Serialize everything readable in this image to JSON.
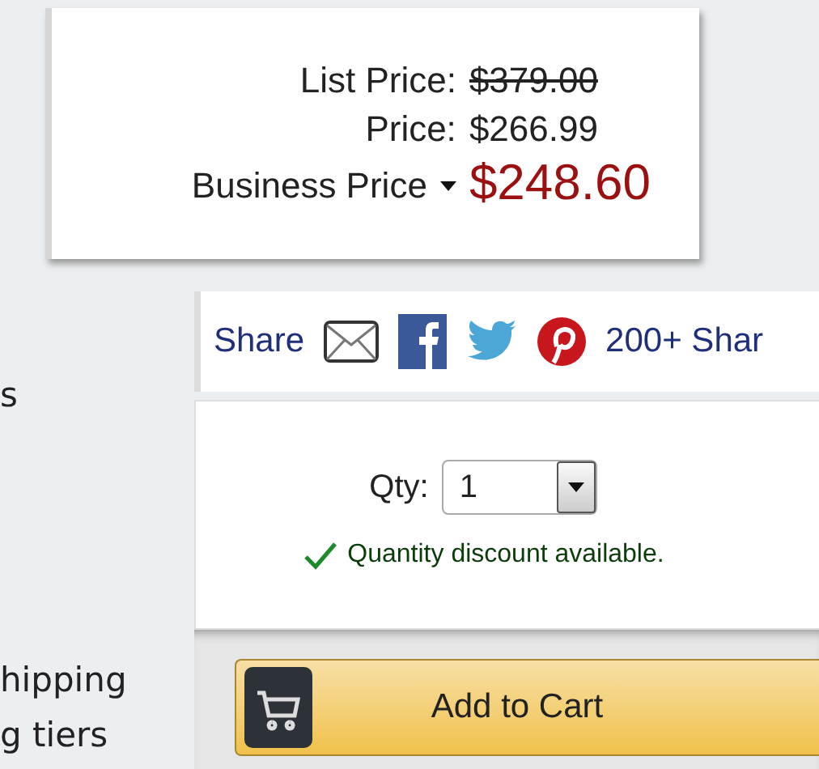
{
  "price_box": {
    "list_price_label": "List Price:",
    "list_price": "$379.00",
    "price_label": "Price:",
    "price": "$266.99",
    "business_price_label": "Business Price",
    "business_price": "$248.60"
  },
  "slide_text": [
    "s",
    "hipping",
    "g tiers"
  ],
  "share_bar": {
    "label": "Share",
    "share_count": "200+ Shar"
  },
  "quantity": {
    "label": "Qty:",
    "value": "1",
    "discount_note": "Quantity discount available."
  },
  "add_to_cart": {
    "label": "Add to Cart"
  }
}
